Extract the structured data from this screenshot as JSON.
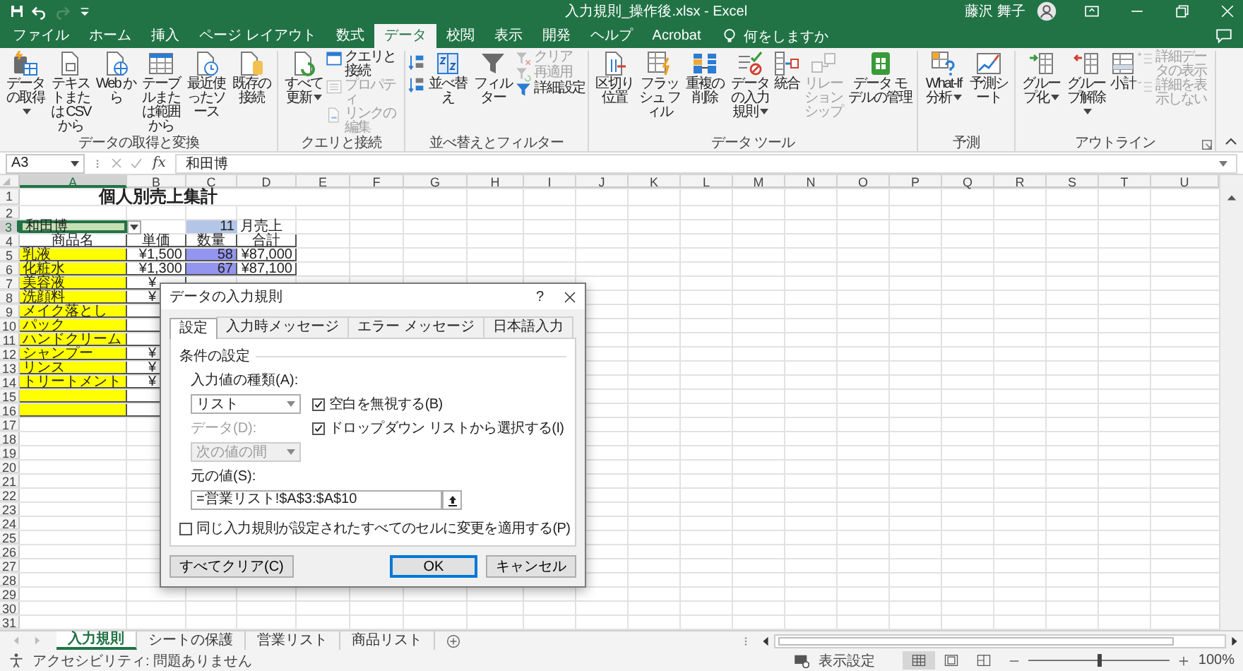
{
  "window": {
    "title": "入力規則_操作後.xlsx - Excel",
    "user": "藤沢 舞子"
  },
  "quick_access": [
    {
      "kind": "save",
      "disabled": false
    },
    {
      "kind": "undo",
      "disabled": false
    },
    {
      "kind": "redo",
      "disabled": true
    },
    {
      "kind": "customize",
      "disabled": false
    }
  ],
  "menu_tabs": [
    {
      "label": "ファイル",
      "selected": false
    },
    {
      "label": "ホーム",
      "selected": false
    },
    {
      "label": "挿入",
      "selected": false
    },
    {
      "label": "ページ レイアウト",
      "selected": false
    },
    {
      "label": "数式",
      "selected": false
    },
    {
      "label": "データ",
      "selected": true
    },
    {
      "label": "校閲",
      "selected": false
    },
    {
      "label": "表示",
      "selected": false
    },
    {
      "label": "開発",
      "selected": false
    },
    {
      "label": "ヘルプ",
      "selected": false
    },
    {
      "label": "Acrobat",
      "selected": false
    }
  ],
  "tell_me": "何をしますか",
  "ribbon": {
    "groups": [
      {
        "label": "データの取得と変換",
        "items": [
          {
            "kind": "large",
            "label": "データの取得",
            "caret": true,
            "disabled": false
          },
          {
            "kind": "large",
            "label": "テキストまたは CSV から",
            "caret": false,
            "disabled": false
          },
          {
            "kind": "large",
            "label": "Web から",
            "caret": false,
            "disabled": false
          },
          {
            "kind": "large",
            "label": "テーブルまたは範囲から",
            "caret": false,
            "disabled": false
          },
          {
            "kind": "large",
            "label": "最近使ったソース",
            "caret": false,
            "disabled": false
          },
          {
            "kind": "large",
            "label": "既存の接続",
            "caret": false,
            "disabled": false
          }
        ]
      },
      {
        "label": "クエリと接続",
        "items": [
          {
            "kind": "large",
            "label": "すべて更新",
            "caret": true,
            "disabled": false
          },
          {
            "kind": "stack",
            "entries": [
              {
                "label": "クエリと接続",
                "disabled": false
              },
              {
                "label": "プロパティ",
                "disabled": true
              },
              {
                "label": "リンクの編集",
                "disabled": true
              }
            ]
          }
        ]
      },
      {
        "label": "並べ替えとフィルター",
        "items": [
          {
            "kind": "sort"
          },
          {
            "kind": "large",
            "label": "並べ替え",
            "caret": false,
            "disabled": false
          },
          {
            "kind": "large",
            "label": "フィルター",
            "caret": false,
            "disabled": false
          },
          {
            "kind": "stack",
            "entries": [
              {
                "label": "クリア",
                "disabled": true
              },
              {
                "label": "再適用",
                "disabled": true
              },
              {
                "label": "詳細設定",
                "disabled": false
              }
            ]
          }
        ]
      },
      {
        "label": "データ ツール",
        "items": [
          {
            "kind": "large",
            "label": "区切り位置",
            "caret": false,
            "disabled": false
          },
          {
            "kind": "large",
            "label": "フラッシュ フィル",
            "caret": false,
            "disabled": false
          },
          {
            "kind": "large",
            "label": "重複の削除",
            "caret": false,
            "disabled": false
          },
          {
            "kind": "large",
            "label": "データの入力規則",
            "caret": true,
            "disabled": false
          },
          {
            "kind": "large",
            "label": "統合",
            "caret": false,
            "disabled": false
          },
          {
            "kind": "large",
            "label": "リレーションシップ",
            "caret": false,
            "disabled": true
          },
          {
            "kind": "large",
            "label": "データ モデルの管理",
            "caret": false,
            "disabled": false
          }
        ]
      },
      {
        "label": "予測",
        "items": [
          {
            "kind": "large",
            "label": "What-If 分析",
            "caret": true,
            "disabled": false
          },
          {
            "kind": "large",
            "label": "予測シート",
            "caret": false,
            "disabled": false
          }
        ]
      },
      {
        "label": "アウトライン",
        "items": [
          {
            "kind": "large",
            "label": "グループ化",
            "caret": true,
            "disabled": false
          },
          {
            "kind": "large",
            "label": "グループ解除",
            "caret": true,
            "disabled": false
          },
          {
            "kind": "large",
            "label": "小計",
            "caret": false,
            "disabled": false
          },
          {
            "kind": "stack",
            "entries": [
              {
                "label": "詳細データの表示",
                "disabled": true
              },
              {
                "label": "詳細を表示しない",
                "disabled": true
              }
            ]
          }
        ]
      }
    ]
  },
  "formula_bar": {
    "name_box": "A3",
    "function_button": "fx",
    "formula": "和田博"
  },
  "sheet": {
    "columns": [
      {
        "label": "A",
        "selected": true
      },
      {
        "label": "B",
        "selected": false
      },
      {
        "label": "C",
        "selected": false
      },
      {
        "label": "D",
        "selected": false
      },
      {
        "label": "E",
        "selected": false
      },
      {
        "label": "F",
        "selected": false
      },
      {
        "label": "G",
        "selected": false
      },
      {
        "label": "H",
        "selected": false
      },
      {
        "label": "I",
        "selected": false
      },
      {
        "label": "J",
        "selected": false
      },
      {
        "label": "K",
        "selected": false
      },
      {
        "label": "L",
        "selected": false
      },
      {
        "label": "M",
        "selected": false
      },
      {
        "label": "N",
        "selected": false
      },
      {
        "label": "O",
        "selected": false
      },
      {
        "label": "P",
        "selected": false
      },
      {
        "label": "Q",
        "selected": false
      },
      {
        "label": "R",
        "selected": false
      },
      {
        "label": "S",
        "selected": false
      },
      {
        "label": "T",
        "selected": false
      },
      {
        "label": "U",
        "selected": false
      }
    ],
    "rows": [
      {
        "label": "1",
        "selected": false,
        "kind": "title",
        "cells": [
          {
            "text": "個人別売上集計"
          }
        ]
      },
      {
        "label": "2",
        "selected": false,
        "kind": "plain"
      },
      {
        "label": "3",
        "selected": true,
        "kind": "plain",
        "cells": [
          {
            "text": "和田博",
            "kind": "text",
            "color": "#c6e0b4"
          },
          {
            "kind": "dropdown"
          },
          {
            "text": "11",
            "kind": "number",
            "color": "#b4c6e7"
          },
          {
            "text": "月売上",
            "kind": "text"
          }
        ]
      },
      {
        "label": "4",
        "selected": false,
        "kind": "table",
        "cells": [
          {
            "text": "商品名",
            "kind": "header"
          },
          {
            "text": "単価",
            "kind": "header"
          },
          {
            "text": "数量",
            "kind": "header"
          },
          {
            "text": "合計",
            "kind": "header"
          }
        ]
      },
      {
        "label": "5",
        "selected": false,
        "kind": "table",
        "cells": [
          {
            "text": "乳液",
            "kind": "text",
            "color": "#ffff00"
          },
          {
            "text": "¥1,500",
            "kind": "number"
          },
          {
            "text": "58",
            "kind": "number",
            "color": "#9395ef"
          },
          {
            "text": "¥87,000",
            "kind": "number"
          }
        ]
      },
      {
        "label": "6",
        "selected": false,
        "kind": "table",
        "cells": [
          {
            "text": "化粧水",
            "kind": "text",
            "color": "#ffff00"
          },
          {
            "text": "¥1,300",
            "kind": "number"
          },
          {
            "text": "67",
            "kind": "number",
            "color": "#9395ef"
          },
          {
            "text": "¥87,100",
            "kind": "number"
          }
        ]
      },
      {
        "label": "7",
        "selected": false,
        "kind": "table",
        "cells": [
          {
            "text": "美容液",
            "kind": "text",
            "color": "#ffff00"
          },
          {
            "text": "¥",
            "kind": "partial"
          }
        ]
      },
      {
        "label": "8",
        "selected": false,
        "kind": "table",
        "cells": [
          {
            "text": "洗顔料",
            "kind": "text",
            "color": "#ffff00"
          },
          {
            "text": "¥",
            "kind": "partial"
          }
        ]
      },
      {
        "label": "9",
        "selected": false,
        "kind": "table",
        "cells": [
          {
            "text": "メイク落とし",
            "kind": "text",
            "color": "#ffff00"
          }
        ]
      },
      {
        "label": "10",
        "selected": false,
        "kind": "table",
        "cells": [
          {
            "text": "パック",
            "kind": "text",
            "color": "#ffff00"
          }
        ]
      },
      {
        "label": "11",
        "selected": false,
        "kind": "table",
        "cells": [
          {
            "text": "ハンドクリーム",
            "kind": "text",
            "color": "#ffff00"
          }
        ]
      },
      {
        "label": "12",
        "selected": false,
        "kind": "table",
        "cells": [
          {
            "text": "シャンプー",
            "kind": "text",
            "color": "#ffff00"
          },
          {
            "text": "¥",
            "kind": "partial"
          }
        ]
      },
      {
        "label": "13",
        "selected": false,
        "kind": "table",
        "cells": [
          {
            "text": "リンス",
            "kind": "text",
            "color": "#ffff00"
          },
          {
            "text": "¥",
            "kind": "partial"
          }
        ]
      },
      {
        "label": "14",
        "selected": false,
        "kind": "table",
        "cells": [
          {
            "text": "トリートメント",
            "kind": "text",
            "color": "#ffff00"
          },
          {
            "text": "¥",
            "kind": "partial"
          }
        ]
      },
      {
        "label": "15",
        "selected": false,
        "kind": "table",
        "cells": [
          {
            "color": "#ffff00"
          }
        ]
      },
      {
        "label": "16",
        "selected": false,
        "kind": "table",
        "cells": [
          {
            "color": "#ffff00"
          }
        ]
      },
      {
        "label": "17",
        "selected": false,
        "kind": "plain"
      },
      {
        "label": "18",
        "selected": false,
        "kind": "plain"
      },
      {
        "label": "19",
        "selected": false,
        "kind": "plain"
      },
      {
        "label": "20",
        "selected": false,
        "kind": "plain"
      },
      {
        "label": "21",
        "selected": false,
        "kind": "plain"
      },
      {
        "label": "22",
        "selected": false,
        "kind": "plain"
      },
      {
        "label": "23",
        "selected": false,
        "kind": "plain"
      },
      {
        "label": "24",
        "selected": false,
        "kind": "plain"
      },
      {
        "label": "25",
        "selected": false,
        "kind": "plain"
      },
      {
        "label": "26",
        "selected": false,
        "kind": "plain"
      },
      {
        "label": "27",
        "selected": false,
        "kind": "plain"
      },
      {
        "label": "28",
        "selected": false,
        "kind": "plain"
      },
      {
        "label": "29",
        "selected": false,
        "kind": "plain"
      },
      {
        "label": "30",
        "selected": false,
        "kind": "plain"
      },
      {
        "label": "31",
        "selected": false,
        "kind": "plain"
      }
    ]
  },
  "sheet_tabs": [
    {
      "label": "入力規則",
      "selected": true
    },
    {
      "label": "シートの保護",
      "selected": false
    },
    {
      "label": "営業リスト",
      "selected": false
    },
    {
      "label": "商品リスト",
      "selected": false
    }
  ],
  "status_bar": {
    "accessibility": "アクセシビリティ: 問題ありません",
    "display_settings": "表示設定",
    "views": [
      {
        "kind": "normal",
        "selected": true
      },
      {
        "kind": "page-layout",
        "selected": false
      },
      {
        "kind": "page-break",
        "selected": false
      }
    ],
    "zoom": {
      "level": 0.5,
      "reading": "100%"
    }
  },
  "dialog": {
    "title": "データの入力規則",
    "help": "?",
    "tabs": [
      {
        "label": "設定",
        "selected": true
      },
      {
        "label": "入力時メッセージ",
        "selected": false
      },
      {
        "label": "エラー メッセージ",
        "selected": false
      },
      {
        "label": "日本語入力",
        "selected": false
      }
    ],
    "section": "条件の設定",
    "allow": {
      "label": "入力値の種類(A):",
      "value": "リスト",
      "disabled": false
    },
    "data": {
      "label": "データ(D):",
      "value": "次の値の間",
      "disabled": true
    },
    "options": [
      {
        "label": "空白を無視する(B)",
        "checked": true
      },
      {
        "label": "ドロップダウン リストから選択する(I)",
        "checked": true
      }
    ],
    "source": {
      "label": "元の値(S):",
      "value": "=営業リスト!$A$3:$A$10"
    },
    "apply_all": {
      "label": "同じ入力規則が設定されたすべてのセルに変更を適用する(P)",
      "checked": false
    },
    "buttons": [
      {
        "label": "すべてクリア(C)",
        "kind": "plain"
      },
      {
        "label": "OK",
        "kind": "default"
      },
      {
        "label": "キャンセル",
        "kind": "plain"
      }
    ]
  }
}
